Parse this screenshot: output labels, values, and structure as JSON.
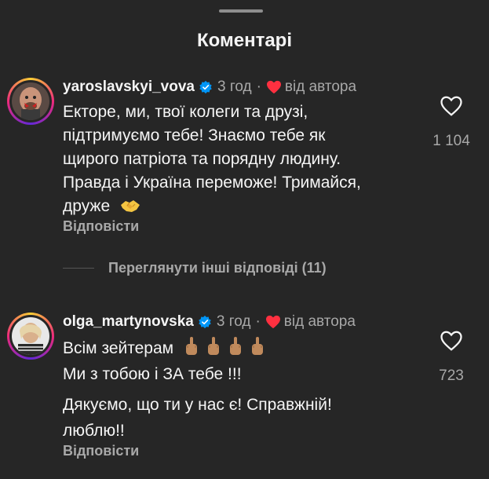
{
  "sheet": {
    "title": "Коментарі"
  },
  "comments": [
    {
      "username": "yaroslavskyi_vova",
      "time": "3 год",
      "separator": "·",
      "author_badge": "від автора",
      "lines": [
        "Екторе, ми, твої колеги та друзі,",
        "підтримуємо тебе! Знаємо тебе як",
        "щирого патріота та порядну людину.",
        "Правда і Україна переможе! Тримайся,",
        "друже"
      ],
      "emoji": "handshake-icon",
      "reply_label": "Відповісти",
      "like_count": "1 104"
    },
    {
      "username": "olga_martynovska",
      "time": "3 год",
      "separator": "·",
      "author_badge": "від автора",
      "lines": [
        "Всім зейтерам",
        "Ми з тобою і ЗА тебе !!!",
        "Дякуємо, що ти у нас є! Справжній!",
        "люблю!!"
      ],
      "emoji": "middle-finger-icon",
      "reply_label": "Відповісти",
      "like_count": "723"
    }
  ],
  "more_replies": "Переглянути інші відповіді (11)",
  "colors": {
    "background": "#262626",
    "text": "#f5f5f5",
    "secondary": "#a8a8a8",
    "verified": "#0095f6",
    "heart": "#ff3040"
  }
}
